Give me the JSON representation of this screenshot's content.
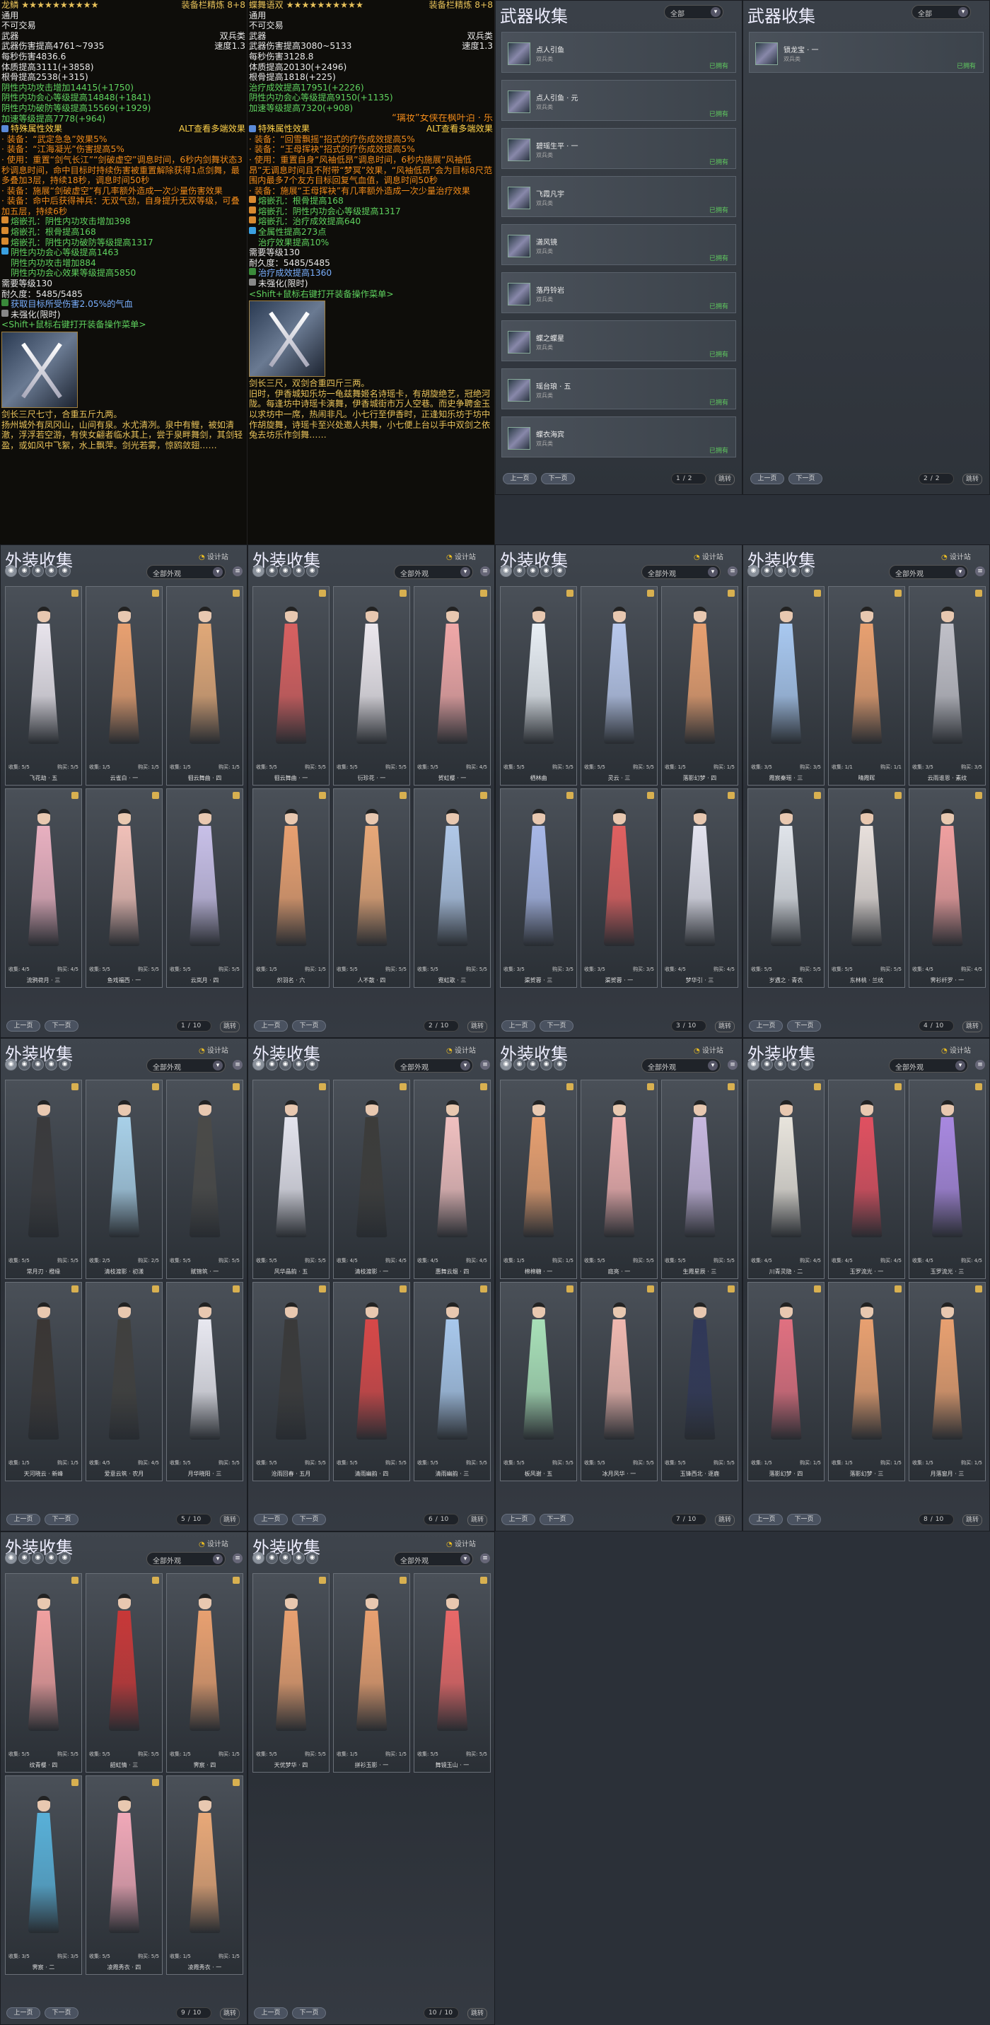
{
  "tooltip_left": {
    "header_left": "龙鳞 ★★★★★★★★★★",
    "header_right": "装备栏精炼 8+8",
    "lines": [
      {
        "l": "通用",
        "r": "",
        "c": "c-w"
      },
      {
        "l": "不可交易",
        "r": "",
        "c": "c-w"
      },
      {
        "l": "武器",
        "r": "双兵类",
        "c": "c-w"
      },
      {
        "l": "武器伤害提高4761~7935",
        "r": "速度1.3",
        "c": "c-w"
      },
      {
        "l": "每秒伤害4836.6",
        "r": "",
        "c": "c-w"
      },
      {
        "l": "体质提高3111(+3858)",
        "r": "",
        "c": "c-w"
      },
      {
        "l": "根骨提高2538(+315)",
        "r": "",
        "c": "c-w"
      },
      {
        "l": "阴性内功攻击增加14415(+1750)",
        "r": "",
        "c": "c-g"
      },
      {
        "l": "阴性内功会心等级提高14848(+1841)",
        "r": "",
        "c": "c-g"
      },
      {
        "l": "阴性内功破防等级提高15569(+1929)",
        "r": "",
        "c": "c-g"
      },
      {
        "l": "加速等级提高7778(+964)",
        "r": "",
        "c": "c-g"
      }
    ],
    "special_title": "特殊属性效果",
    "special_hint": "ALT查看多端效果",
    "special_lines": [
      "· 装备：“武定急急”效果5%",
      "· 装备：“江海凝光”伤害提高5%",
      "· 使用：重置“剑气长江”“剑破虚空”调息时间，6秒内剑舞状态3秒调息时间，命中目标时持续伤害被重置解除获得1点剑舞，最多叠加3层，持续18秒，调息时间50秒",
      "· 装备：施展“剑破虚空”有几率额外造成一次少量伤害效果",
      "· 装备：命中后获得神兵：无双气劲，自身提升无双等级，可叠加五层，持续6秒"
    ],
    "gems": [
      "熔嵌孔：阴性内功攻击增加398",
      "熔嵌孔：根骨提高168",
      "熔嵌孔：阴性内功破防等级提高1317"
    ],
    "extra": [
      "阴性内功会心等级提高1463",
      "阴性内功攻击增加884",
      "阴性内功会心效果等级提高5850"
    ],
    "req_level": "需要等级130",
    "durability": "耐久度：5485/5485",
    "proc": "获取目标所受伤害2.05%的气血",
    "unrefined": "未强化(限时)",
    "shift_hint": "<Shift+鼠标右键打开装备操作菜单>",
    "desc_lines": [
      "剑长三尺七寸，合重五斤九两。",
      "扬州城外有凤冈山，山间有泉。水尤清冽。泉中有鲤，被如清澈，浮浮若空游，有侠女翩者临水其上，尝于泉畔舞剑，其剑轻盈，或如风中飞絮，水上飘萍。剑光若雾，惊鸥敛翅……"
    ]
  },
  "tooltip_right": {
    "header_left": "蝶舞语双 ★★★★★★★★★★",
    "header_right": "装备栏精炼 8+8",
    "lines": [
      {
        "l": "通用",
        "r": "",
        "c": "c-w"
      },
      {
        "l": "不可交易",
        "r": "",
        "c": "c-w"
      },
      {
        "l": "武器",
        "r": "双兵类",
        "c": "c-w"
      },
      {
        "l": "武器伤害提高3080~5133",
        "r": "速度1.3",
        "c": "c-w"
      },
      {
        "l": "每秒伤害3128.8",
        "r": "",
        "c": "c-w"
      },
      {
        "l": "体质提高20130(+2496)",
        "r": "",
        "c": "c-w"
      },
      {
        "l": "根骨提高1818(+225)",
        "r": "",
        "c": "c-w"
      },
      {
        "l": "治疗成效提高17951(+2226)",
        "r": "",
        "c": "c-g"
      },
      {
        "l": "阴性内功会心等级提高9150(+1135)",
        "r": "",
        "c": "c-g"
      },
      {
        "l": "加速等级提高7320(+908)",
        "r": "",
        "c": "c-g"
      }
    ],
    "banner": "“璃妆”女侠在枫叶泊 · 乐",
    "special_title": "特殊属性效果",
    "special_hint": "ALT查看多端效果",
    "special_lines": [
      "· 装备：“回雪飘摇”招式的疗伤成效提高5%",
      "· 装备：“王母挥袂”招式的疗伤成效提高5%",
      "· 使用：重置自身“风袖低昂”调息时间，6秒内施展“风袖低昂”无调息时间且不附带“梦冥”效果，“风袖低昂”会为目标8尺范围内最多7个友方目标回复气血值，调息时间50秒",
      "· 装备：施展“王母挥袂”有几率额外造成一次少量治疗效果"
    ],
    "gems": [
      "熔嵌孔：根骨提高168",
      "熔嵌孔：阴性内功会心等级提高1317",
      "熔嵌孔：治疗成效提高640"
    ],
    "extra": [
      "全属性提高273点",
      "治疗效果提高10%"
    ],
    "req_level": "需要等级130",
    "durability": "耐久度：5485/5485",
    "proc": "治疗成效提高1360",
    "unrefined": "未强化(限时)",
    "shift_hint": "<Shift+鼠标右键打开装备操作菜单>",
    "desc_lines": [
      "剑长三尺，双剑合重四斤三两。",
      "旧时，伊香城知乐坊一龟兹舞姬名诗瑶卡，有胡旋绝艺，冠绝河陇。每逢坊中诗瑶卡演舞，伊香城街市万人空巷。而史争聘金玉以求坊中一席，热闹非凡。小七行至伊香时，正逢知乐坊于坊中作胡旋舞，诗瑶卡至兴处邀人共舞，小七便上台以手中双剑之依兔去坊乐作剑舞……"
    ]
  },
  "weapon_panels": [
    {
      "title": "武器收集",
      "filter": "全部",
      "items": [
        {
          "name": "点人引鱼",
          "sub": "双兵类",
          "status": "已拥有"
        },
        {
          "name": "点人引鱼 · 元",
          "sub": "双兵类",
          "status": "已拥有"
        },
        {
          "name": "碧瑶生平 · 一",
          "sub": "双兵类",
          "status": "已拥有"
        },
        {
          "name": "飞霞凡宇",
          "sub": "双兵类",
          "status": "已拥有"
        },
        {
          "name": "潇风镜",
          "sub": "双兵类",
          "status": "已拥有"
        },
        {
          "name": "落丹铃岩",
          "sub": "双兵类",
          "status": "已拥有"
        },
        {
          "name": "蝶之蝶星",
          "sub": "双兵类",
          "status": "已拥有"
        },
        {
          "name": "瑶台琅 · 五",
          "sub": "双兵类",
          "status": "已拥有"
        },
        {
          "name": "蝶衣海宾",
          "sub": "双兵类",
          "status": "已拥有"
        }
      ],
      "prev": "上一页",
      "next": "下一页",
      "page": "1",
      "total": "2",
      "jump": "跳转"
    },
    {
      "title": "武器收集",
      "filter": "全部",
      "items": [
        {
          "name": "锁龙宝 · 一",
          "sub": "双兵类",
          "status": "已拥有"
        }
      ],
      "prev": "上一页",
      "next": "下一页",
      "page": "2",
      "total": "2",
      "jump": "跳转"
    }
  ],
  "outfit_common": {
    "title": "外装收集",
    "fav": "设计站",
    "filter": "全部外观",
    "prev": "上一页",
    "next": "下一页",
    "jump": "跳转",
    "stat_a": "收集",
    "stat_b": "购买",
    "tab_icons": [
      "hair-icon",
      "face-icon",
      "top-icon",
      "pants-icon",
      "cape-icon",
      "waist-icon",
      "bag-icon",
      "shoe-icon",
      "weapon-icon",
      "back-icon"
    ]
  },
  "outfit_panels": [
    {
      "page": "1",
      "total": "10",
      "items": [
        {
          "name": "飞花劫 · 五",
          "a": "5/5",
          "b": "5/5",
          "color": "#e8e4ec"
        },
        {
          "name": "云雀白 · 一",
          "a": "1/5",
          "b": "1/5",
          "color": "#e8a070"
        },
        {
          "name": "徊云舞曲 · 四",
          "a": "1/5",
          "b": "1/5",
          "color": "#e0a878"
        },
        {
          "name": "流鸦荷月 · 三",
          "a": "4/5",
          "b": "4/5",
          "color": "#e8b0c0"
        },
        {
          "name": "鱼戏福西 · 一",
          "a": "5/5",
          "b": "5/5",
          "color": "#f0c0b8"
        },
        {
          "name": "云岚月 · 四",
          "a": "5/5",
          "b": "5/5",
          "color": "#c8c0e8"
        }
      ]
    },
    {
      "page": "2",
      "total": "10",
      "items": [
        {
          "name": "徊云舞曲 · 一",
          "a": "5/5",
          "b": "5/5",
          "color": "#d86060"
        },
        {
          "name": "衍珍花 · 一",
          "a": "5/5",
          "b": "5/5",
          "color": "#ece8ee"
        },
        {
          "name": "贺虹樱 · 一",
          "a": "5/5",
          "b": "4/5",
          "color": "#f0a8a8"
        },
        {
          "name": "炽羽名 · 六",
          "a": "1/5",
          "b": "1/5",
          "color": "#e8a070"
        },
        {
          "name": "人不散 · 四",
          "a": "5/5",
          "b": "5/5",
          "color": "#e8a878"
        },
        {
          "name": "霓虹歌 · 三",
          "a": "5/5",
          "b": "5/5",
          "color": "#b0c8e8"
        }
      ]
    },
    {
      "page": "3",
      "total": "10",
      "items": [
        {
          "name": "栖林曲",
          "a": "5/5",
          "b": "5/5",
          "color": "#e8eef4"
        },
        {
          "name": "灵云 · 三",
          "a": "5/5",
          "b": "5/5",
          "color": "#b8c8ec"
        },
        {
          "name": "落影幻梦 · 四",
          "a": "1/5",
          "b": "1/5",
          "color": "#e8a070"
        },
        {
          "name": "渠贺蓉 · 三",
          "a": "3/5",
          "b": "3/5",
          "color": "#a8b8e8"
        },
        {
          "name": "渠贺蓉 · 一",
          "a": "3/5",
          "b": "3/5",
          "color": "#e06060"
        },
        {
          "name": "梦华引 · 三",
          "a": "4/5",
          "b": "4/5",
          "color": "#e4e4f0"
        }
      ]
    },
    {
      "page": "4",
      "total": "10",
      "items": [
        {
          "name": "霞宸秦瑶 · 三",
          "a": "3/5",
          "b": "3/5",
          "color": "#a8c8f0"
        },
        {
          "name": "晴霞晖",
          "a": "1/1",
          "b": "1/1",
          "color": "#e8a070"
        },
        {
          "name": "云雨谁恩 · 素纹",
          "a": "3/5",
          "b": "3/5",
          "color": "#c0c0c8"
        },
        {
          "name": "岁遇之 · 青衣",
          "a": "5/5",
          "b": "5/5",
          "color": "#e0e4ea"
        },
        {
          "name": "东林桃 · 兰纹",
          "a": "5/5",
          "b": "5/5",
          "color": "#e8e0dc"
        },
        {
          "name": "霁衫纤罗 · 一",
          "a": "4/5",
          "b": "4/5",
          "color": "#f0a0a0"
        }
      ]
    },
    {
      "page": "5",
      "total": "10",
      "items": [
        {
          "name": "常月刃 · 橙缘",
          "a": "5/5",
          "b": "5/5",
          "color": "#3a3a3c"
        },
        {
          "name": "清枝渡影 · 初漾",
          "a": "2/5",
          "b": "2/5",
          "color": "#a8d0e8"
        },
        {
          "name": "赋锦筑 · 一",
          "a": "5/5",
          "b": "5/5",
          "color": "#4a4a48"
        },
        {
          "name": "天河晓云 · 新峰",
          "a": "1/5",
          "b": "1/5",
          "color": "#3a3634"
        },
        {
          "name": "爱意云筑 · 农月",
          "a": "4/5",
          "b": "4/5",
          "color": "#40403e"
        },
        {
          "name": "月华晓阳 · 三",
          "a": "5/5",
          "b": "5/5",
          "color": "#e8e8f0"
        }
      ]
    },
    {
      "page": "6",
      "total": "10",
      "items": [
        {
          "name": "风华晶韵 · 五",
          "a": "5/5",
          "b": "5/5",
          "color": "#e4e4ee"
        },
        {
          "name": "清枝渡影 · 一",
          "a": "4/5",
          "b": "4/5",
          "color": "#3c3c3a"
        },
        {
          "name": "惠舞云烟 · 四",
          "a": "4/5",
          "b": "4/5",
          "color": "#f0c0c0"
        },
        {
          "name": "沧雨回春 · 五月",
          "a": "5/5",
          "b": "5/5",
          "color": "#3a3a3a"
        },
        {
          "name": "清雨幽韵 · 四",
          "a": "5/5",
          "b": "5/5",
          "color": "#d84848"
        },
        {
          "name": "清雨幽韵 · 三",
          "a": "5/5",
          "b": "5/5",
          "color": "#a8c8ec"
        }
      ]
    },
    {
      "page": "7",
      "total": "10",
      "items": [
        {
          "name": "棉棉糖 · 一",
          "a": "1/5",
          "b": "1/5",
          "color": "#e8a070"
        },
        {
          "name": "庭亮 · 一",
          "a": "5/5",
          "b": "5/5",
          "color": "#f0b0b0"
        },
        {
          "name": "生霞星辰 · 三",
          "a": "5/5",
          "b": "5/5",
          "color": "#c8b8e0"
        },
        {
          "name": "板风谢 · 五",
          "a": "5/5",
          "b": "5/5",
          "color": "#a8e0b8"
        },
        {
          "name": "冰月风华 · 一",
          "a": "5/5",
          "b": "5/5",
          "color": "#f0b8b0"
        },
        {
          "name": "玉锋西北 · 逐鹿",
          "a": "5/5",
          "b": "5/5",
          "color": "#303858"
        }
      ]
    },
    {
      "page": "8",
      "total": "10",
      "items": [
        {
          "name": "川青灵隐 · 二",
          "a": "4/5",
          "b": "4/5",
          "color": "#e8e4dc"
        },
        {
          "name": "玉罗流光 · 一",
          "a": "4/5",
          "b": "4/5",
          "color": "#e05060"
        },
        {
          "name": "玉罗流光 · 三",
          "a": "4/5",
          "b": "4/5",
          "color": "#a888e0"
        },
        {
          "name": "落影幻梦 · 四",
          "a": "1/5",
          "b": "1/5",
          "color": "#e07080"
        },
        {
          "name": "落影幻梦 · 三",
          "a": "1/5",
          "b": "1/5",
          "color": "#e8a070"
        },
        {
          "name": "月落窗月 · 三",
          "a": "1/5",
          "b": "1/5",
          "color": "#e8a070"
        }
      ]
    },
    {
      "page": "9",
      "total": "10",
      "items": [
        {
          "name": "纹青樱 · 四",
          "a": "5/5",
          "b": "5/5",
          "color": "#f0a0a0"
        },
        {
          "name": "韶虹情 · 三",
          "a": "5/5",
          "b": "5/5",
          "color": "#c83838"
        },
        {
          "name": "霁宸 · 四",
          "a": "1/5",
          "b": "1/5",
          "color": "#e8a070"
        },
        {
          "name": "霁宸 · 二",
          "a": "3/5",
          "b": "3/5",
          "color": "#58b0d8"
        },
        {
          "name": "凌霞秀衣 · 四",
          "a": "5/5",
          "b": "5/5",
          "color": "#f0a8b8"
        },
        {
          "name": "凌霞秀衣 · 一",
          "a": "1/5",
          "b": "1/5",
          "color": "#e8a878"
        }
      ]
    },
    {
      "page": "10",
      "total": "10",
      "items": [
        {
          "name": "天优梦华 · 四",
          "a": "5/5",
          "b": "5/5",
          "color": "#e8a070"
        },
        {
          "name": "拼衫玉影 · 一",
          "a": "1/5",
          "b": "1/5",
          "color": "#e8a070"
        },
        {
          "name": "舞镜玉山 · 一",
          "a": "5/5",
          "b": "5/5",
          "color": "#e86868"
        }
      ]
    }
  ]
}
